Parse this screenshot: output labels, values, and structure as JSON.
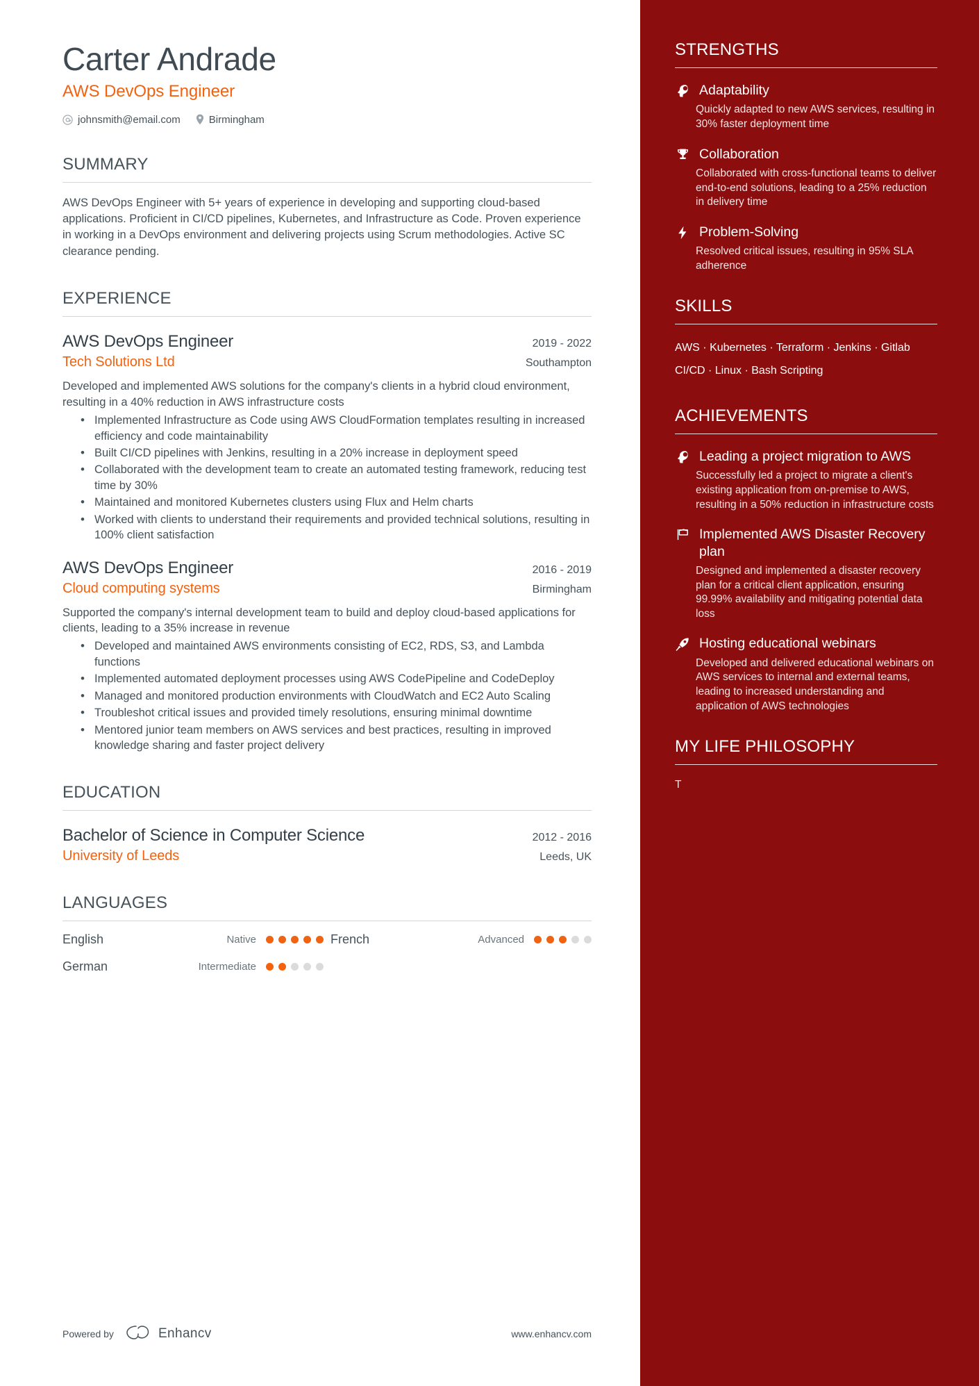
{
  "header": {
    "name": "Carter Andrade",
    "job_title": "AWS DevOps Engineer",
    "email": "johnsmith@email.com",
    "location": "Birmingham"
  },
  "colors": {
    "accent_orange": "#f2620f",
    "sidebar_red": "#8c0d0d",
    "text_dark": "#46525a"
  },
  "summary": {
    "heading": "SUMMARY",
    "text": "AWS DevOps Engineer with 5+ years of experience in developing and supporting cloud-based applications. Proficient in CI/CD pipelines, Kubernetes, and Infrastructure as Code. Proven experience in working in a DevOps environment and delivering projects using Scrum methodologies. Active SC clearance pending."
  },
  "experience": {
    "heading": "EXPERIENCE",
    "entries": [
      {
        "title": "AWS DevOps Engineer",
        "dates": "2019 - 2022",
        "organization": "Tech Solutions Ltd",
        "location": "Southampton",
        "description": "Developed and implemented AWS solutions for the company's clients in a hybrid cloud environment, resulting in a 40% reduction in AWS infrastructure costs",
        "bullets": [
          "Implemented Infrastructure as Code using AWS CloudFormation templates resulting in increased efficiency and code maintainability",
          "Built CI/CD pipelines with Jenkins, resulting in a 20% increase in deployment speed",
          "Collaborated with the development team to create an automated testing framework, reducing test time by 30%",
          "Maintained and monitored Kubernetes clusters using Flux and Helm charts",
          "Worked with clients to understand their requirements and provided technical solutions, resulting in 100% client satisfaction"
        ]
      },
      {
        "title": "AWS DevOps Engineer",
        "dates": "2016 - 2019",
        "organization": "Cloud computing systems",
        "location": "Birmingham",
        "description": "Supported the company's internal development team to build and deploy cloud-based applications for clients, leading to a 35% increase in revenue",
        "bullets": [
          "Developed and maintained AWS environments consisting of EC2, RDS, S3, and Lambda functions",
          "Implemented automated deployment processes using AWS CodePipeline and CodeDeploy",
          "Managed and monitored production environments with CloudWatch and EC2 Auto Scaling",
          "Troubleshot critical issues and provided timely resolutions, ensuring minimal downtime",
          "Mentored junior team members on AWS services and best practices, resulting in improved knowledge sharing and faster project delivery"
        ]
      }
    ]
  },
  "education": {
    "heading": "EDUCATION",
    "entries": [
      {
        "degree": "Bachelor of Science in Computer Science",
        "dates": "2012 - 2016",
        "school": "University of Leeds",
        "location": "Leeds, UK"
      }
    ]
  },
  "languages": {
    "heading": "LANGUAGES",
    "items": [
      {
        "name": "English",
        "level": "Native",
        "rating": 5,
        "max": 5
      },
      {
        "name": "French",
        "level": "Advanced",
        "rating": 3,
        "max": 5
      },
      {
        "name": "German",
        "level": "Intermediate",
        "rating": 2,
        "max": 5
      }
    ]
  },
  "footer": {
    "powered_by": "Powered by",
    "brand": "Enhancv",
    "website": "www.enhancv.com"
  },
  "sidebar": {
    "strengths": {
      "heading": "STRENGTHS",
      "items": [
        {
          "icon": "lightbulb-head-icon",
          "title": "Adaptability",
          "desc": "Quickly adapted to new AWS services, resulting in 30% faster deployment time"
        },
        {
          "icon": "trophy-icon",
          "title": "Collaboration",
          "desc": "Collaborated with cross-functional teams to deliver end-to-end solutions, leading to a 25% reduction in delivery time"
        },
        {
          "icon": "lightning-bolt-icon",
          "title": "Problem-Solving",
          "desc": "Resolved critical issues, resulting in 95% SLA adherence"
        }
      ]
    },
    "skills": {
      "heading": "SKILLS",
      "list": [
        "AWS",
        "Kubernetes",
        "Terraform",
        "Jenkins",
        "Gitlab CI/CD",
        "Linux",
        "Bash Scripting"
      ],
      "separator": " · ",
      "text": "AWS · Kubernetes · Terraform · Jenkins · Gitlab CI/CD · Linux · Bash Scripting"
    },
    "achievements": {
      "heading": "ACHIEVEMENTS",
      "items": [
        {
          "icon": "lightbulb-head-icon",
          "title": "Leading a project migration to AWS",
          "desc": "Successfully led a project to migrate a client's existing application from on-premise to AWS, resulting in a 50% reduction in infrastructure costs"
        },
        {
          "icon": "flag-icon",
          "title": "Implemented AWS Disaster Recovery plan",
          "desc": "Designed and implemented a disaster recovery plan for a critical client application, ensuring 99.99% availability and mitigating potential data loss"
        },
        {
          "icon": "rocket-icon",
          "title": "Hosting educational webinars",
          "desc": "Developed and delivered educational webinars on AWS services to internal and external teams, leading to increased understanding and application of AWS technologies"
        }
      ]
    },
    "philosophy": {
      "heading": "MY LIFE PHILOSOPHY",
      "text": "T"
    }
  }
}
